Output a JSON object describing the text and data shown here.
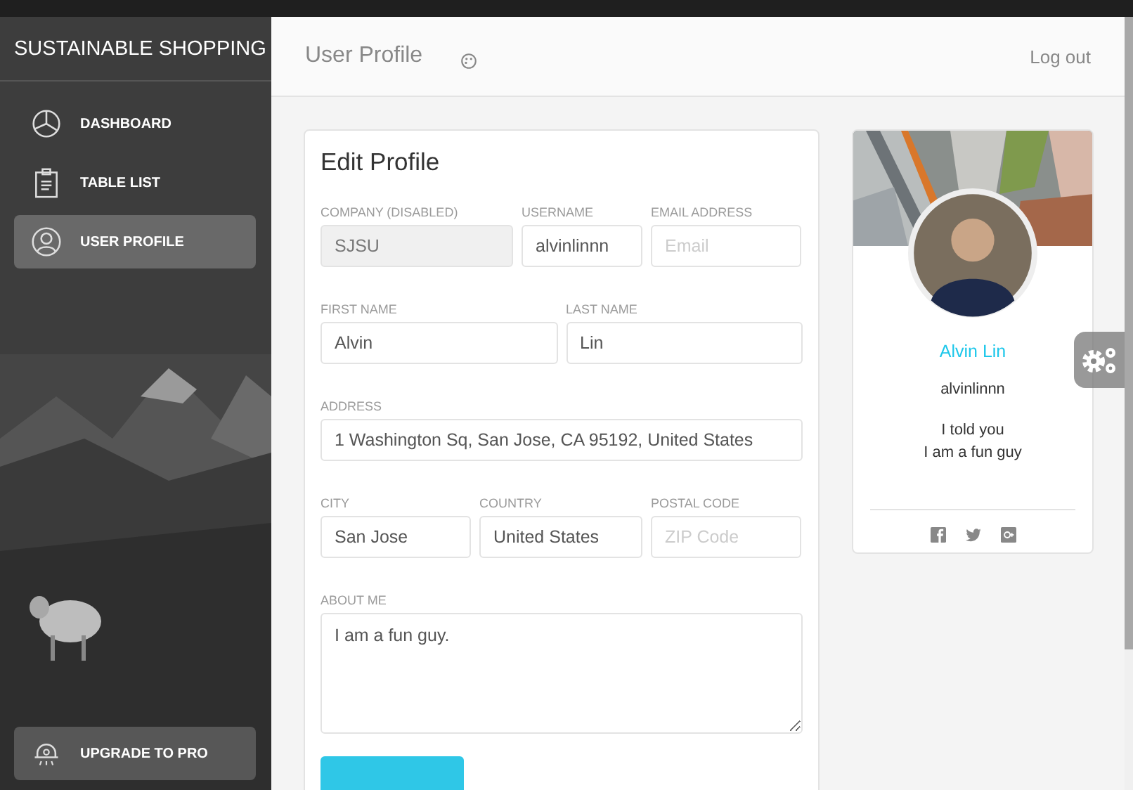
{
  "sidebar": {
    "brand": "SUSTAINABLE SHOPPING",
    "items": [
      {
        "label": "DASHBOARD",
        "selected": false
      },
      {
        "label": "TABLE LIST",
        "selected": false
      },
      {
        "label": "USER PROFILE",
        "selected": true
      }
    ],
    "upgrade_button": "UPGRADE TO PRO"
  },
  "header": {
    "title": "User Profile",
    "logout": "Log out"
  },
  "edit_profile": {
    "title": "Edit Profile",
    "rows": [
      [
        {
          "label": "COMPANY (DISABLED)",
          "value": "SJSU",
          "disabled": true
        },
        {
          "label": "USERNAME",
          "value": "alvinlinnn",
          "disabled": false
        },
        {
          "label": "EMAIL ADDRESS",
          "placeholder": "Email",
          "disabled": false
        }
      ],
      [
        {
          "label": "FIRST NAME",
          "value": "Alvin",
          "disabled": false
        },
        {
          "label": "LAST NAME",
          "value": "Lin",
          "disabled": false
        }
      ],
      [
        {
          "label": "ADDRESS",
          "value": "1 Washington Sq, San Jose, CA 95192, United States",
          "disabled": false
        }
      ],
      [
        {
          "label": "CITY",
          "value": "San Jose",
          "disabled": false
        },
        {
          "label": "COUNTRY",
          "value": "United States",
          "disabled": false
        },
        {
          "label": "POSTAL CODE",
          "placeholder": "ZIP Code",
          "disabled": false
        }
      ]
    ],
    "about": {
      "label": "ABOUT ME",
      "value": "I am a fun guy."
    }
  },
  "profile_card": {
    "name": "Alvin Lin",
    "username": "alvinlinnn",
    "bio": [
      "I told you",
      "I am a fun guy"
    ]
  }
}
